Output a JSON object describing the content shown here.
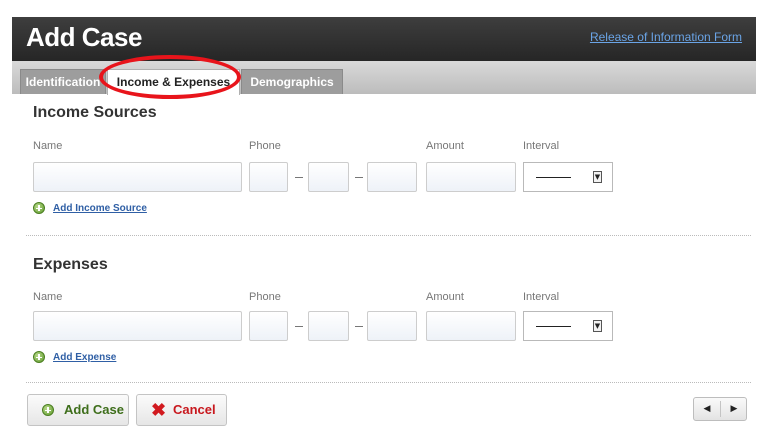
{
  "header": {
    "title": "Add Case",
    "release_link": "Release of Information Form"
  },
  "tabs": [
    {
      "label": "Identification",
      "active": false
    },
    {
      "label": "Income & Expenses",
      "active": true
    },
    {
      "label": "Demographics",
      "active": false
    }
  ],
  "income": {
    "title": "Income Sources",
    "labels": {
      "name": "Name",
      "phone": "Phone",
      "amount": "Amount",
      "interval": "Interval"
    },
    "fields": {
      "name": "",
      "phone_area": "",
      "phone_prefix": "",
      "phone_line": "",
      "amount": "",
      "interval": "——"
    },
    "add_link": "Add Income Source"
  },
  "expenses": {
    "title": "Expenses",
    "labels": {
      "name": "Name",
      "phone": "Phone",
      "amount": "Amount",
      "interval": "Interval"
    },
    "fields": {
      "name": "",
      "phone_area": "",
      "phone_prefix": "",
      "phone_line": "",
      "amount": "",
      "interval": "——"
    },
    "add_link": "Add Expense"
  },
  "footer": {
    "add_case": "Add Case",
    "cancel": "Cancel",
    "prev_icon": "◀",
    "next_icon": "▶"
  },
  "colors": {
    "header_bg": "#2f2f2f",
    "link": "#6aa4e6",
    "highlight": "#e8141b",
    "add_icon": "#5e9a2c",
    "cancel": "#c8181e"
  },
  "icons": {
    "add": "plus-circle-icon",
    "cancel": "x-icon",
    "select_arrow": "dropdown-arrow-icon",
    "prev": "chevron-left-icon",
    "next": "chevron-right-icon"
  }
}
